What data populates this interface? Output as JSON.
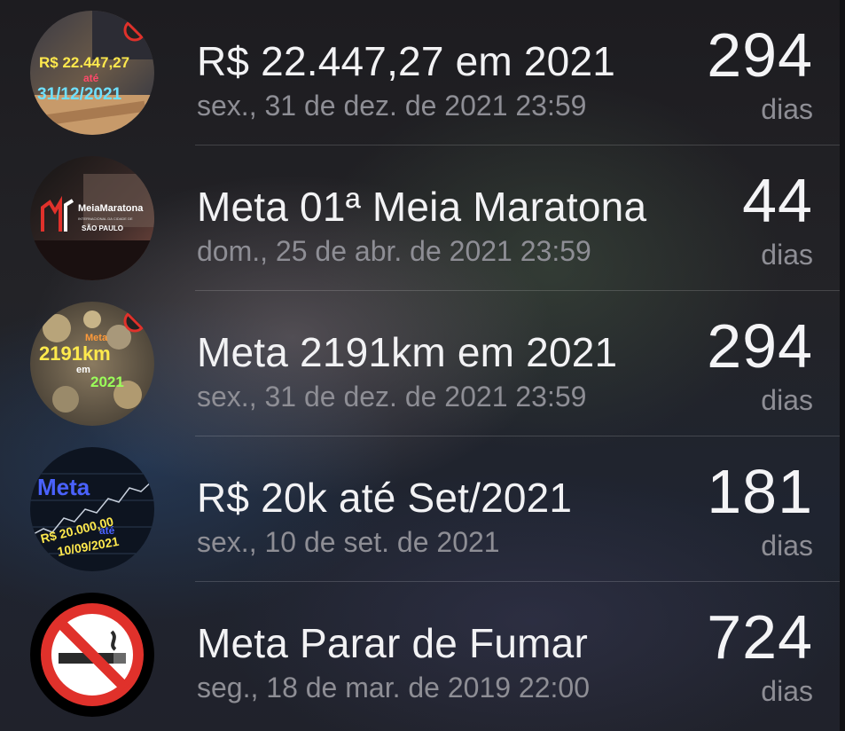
{
  "unit_label": "dias",
  "items": [
    {
      "title": "R$ 22.447,27 em 2021",
      "date": "sex., 31 de dez. de 2021 23:59",
      "count": "294",
      "icon": "money-goal-image",
      "image_text": [
        "R$ 22.447,27",
        "até",
        "31/12/2021"
      ]
    },
    {
      "title": "Meta 01ª Meia Maratona",
      "date": "dom., 25 de abr. de 2021 23:59",
      "count": "44",
      "icon": "half-marathon-logo-image",
      "image_text": [
        "MeiaMaratona",
        "INTERNACIONAL DA CIDADE DE",
        "SÃO PAULO"
      ]
    },
    {
      "title": "Meta 2191km em 2021",
      "date": "sex., 31 de dez. de 2021 23:59",
      "count": "294",
      "icon": "km-goal-image",
      "image_text": [
        "Meta",
        "2191km",
        "em",
        "2021"
      ]
    },
    {
      "title": "R$ 20k até Set/2021",
      "date": "sex., 10 de set. de 2021",
      "count": "181",
      "icon": "stock-chart-goal-image",
      "image_text": [
        "Meta",
        "R$ 20.000,00",
        "até",
        "10/09/2021"
      ]
    },
    {
      "title": "Meta Parar de Fumar",
      "date": "seg., 18 de mar. de 2019 22:00",
      "count": "724",
      "icon": "no-smoking-icon",
      "image_text": []
    }
  ],
  "colors": {
    "title": "#f2f2f4",
    "subtitle": "#8e8e95",
    "no_smoking_red": "#e0312b",
    "goal_yellow": "#ffe94d",
    "goal_cyan": "#6fe0ff",
    "goal_green": "#9bff5a",
    "goal_blue": "#4a62ff"
  }
}
